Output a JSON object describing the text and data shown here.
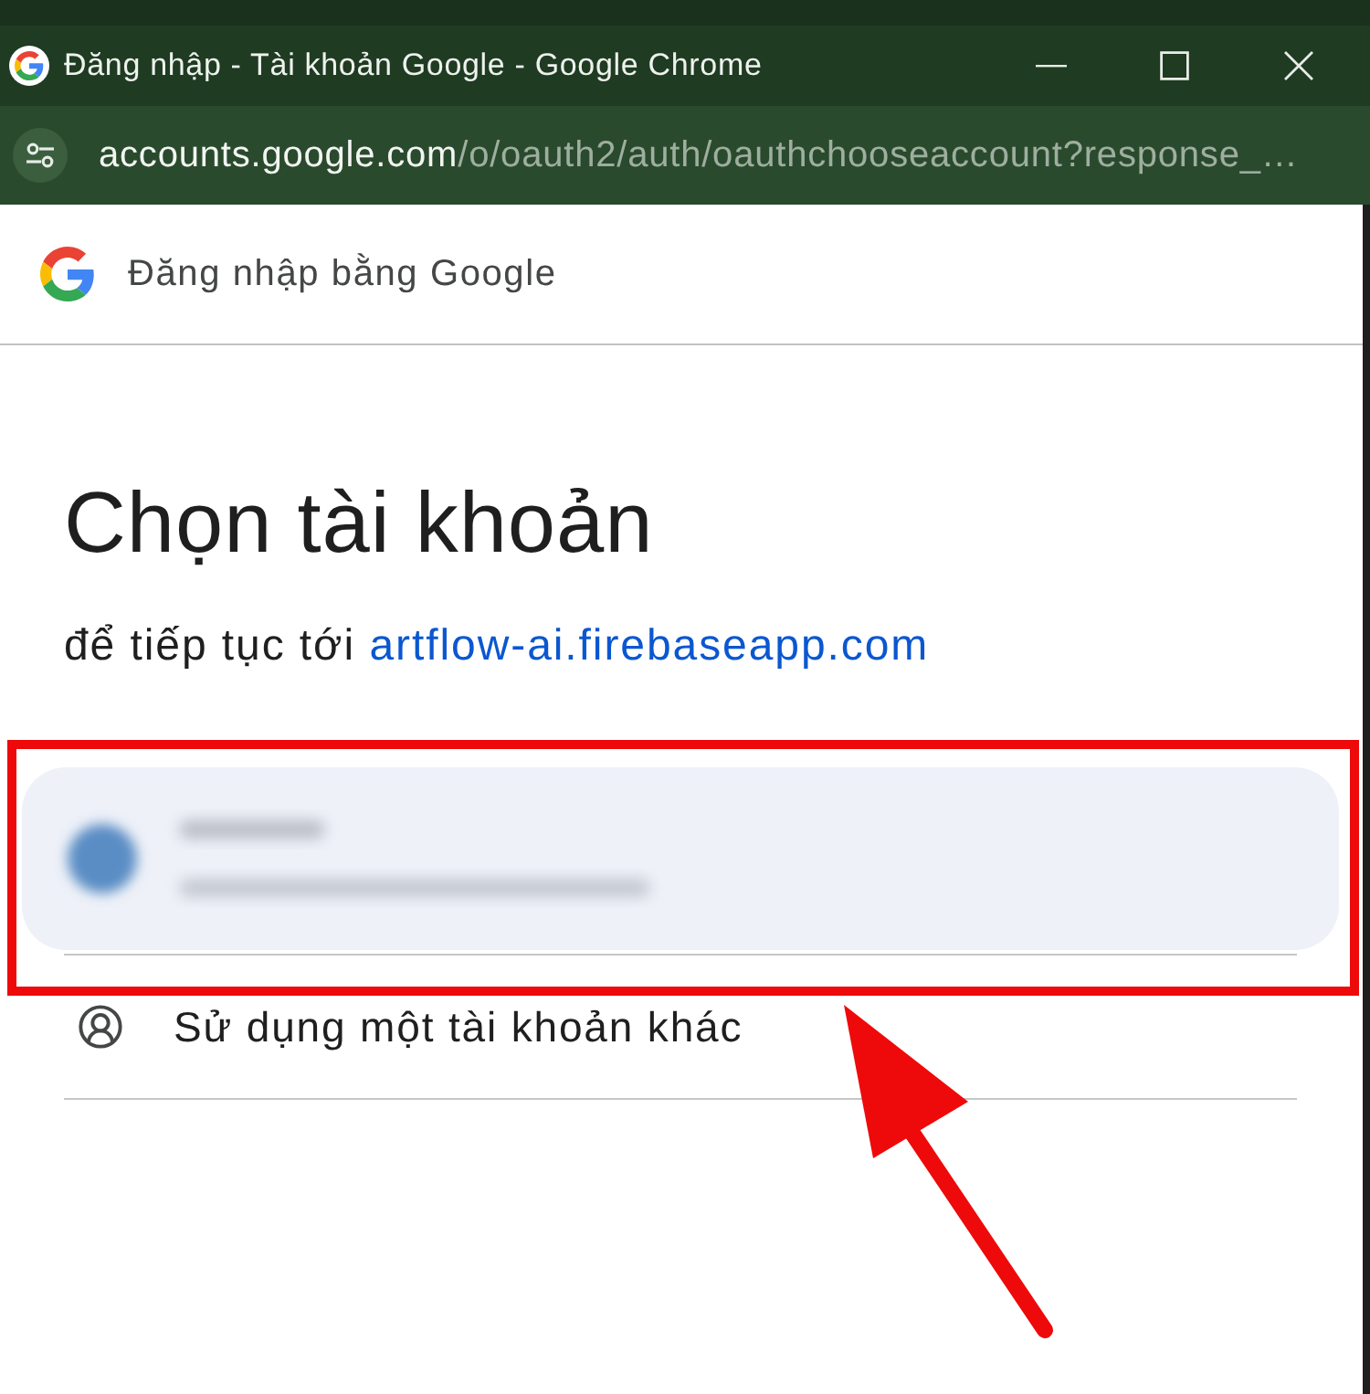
{
  "window": {
    "title": "Đăng nhập - Tài khoản Google - Google Chrome"
  },
  "address_bar": {
    "host": "accounts.google.com",
    "path": "/o/oauth2/auth/oauthchooseaccount?response_…"
  },
  "dialog": {
    "brand": "Đăng nhập bằng Google",
    "heading": "Chọn tài khoản",
    "subtitle": "để tiếp tục tới",
    "app_link": "artflow-ai.firebaseapp.com",
    "items": [
      {
        "kind": "account",
        "selected": true
      },
      {
        "kind": "other_account",
        "label": "Sử dụng một tài khoản khác",
        "selected": false
      }
    ]
  },
  "annotations": {
    "frame": true,
    "arrow": true
  }
}
